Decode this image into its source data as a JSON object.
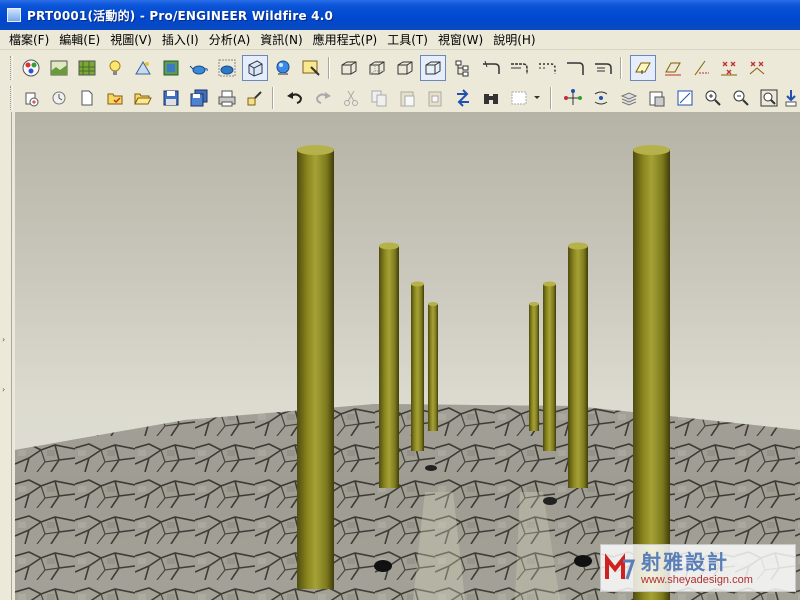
{
  "window": {
    "title": "PRT0001(活動的) - Pro/ENGINEER Wildfire 4.0"
  },
  "menu": {
    "items": [
      "檔案(F)",
      "編輯(E)",
      "視圖(V)",
      "插入(I)",
      "分析(A)",
      "資訊(N)",
      "應用程式(P)",
      "工具(T)",
      "視窗(W)",
      "說明(H)"
    ]
  },
  "toolbar": {
    "row1_icons": [
      "appearance-gallery-icon",
      "scene-icon",
      "texture-icon",
      "light-icon",
      "environment-icon",
      "room-icon",
      "render-teapot-icon",
      "render-region-teapot-icon",
      "render-window-icon",
      "render-preview-icon",
      "render-settings-icon",
      "wireframe-icon",
      "hidden-line-icon",
      "no-hidden-icon",
      "shaded-icon",
      "model-tree-display-icon",
      "saved-view-icon",
      "orient-icon",
      "repaint-icon",
      "spin-center-icon",
      "view-manager-icon",
      "datum-plane-display-icon",
      "datum-axis-display-icon",
      "datum-point-display-icon",
      "coordinate-system-display-icon"
    ],
    "row2_icons": [
      "new-icon",
      "open-icon",
      "save-icon",
      "print-icon",
      "email-icon",
      "undo-icon",
      "redo-icon",
      "cut-icon",
      "copy-icon",
      "paste-icon",
      "paste-special-icon",
      "regenerate-icon",
      "find-icon",
      "select-box-icon",
      "orient-mode-icon",
      "layers-icon",
      "zoom-in-icon",
      "zoom-out-icon",
      "refit-icon",
      "help-context-icon"
    ]
  },
  "viewport": {
    "scene_description": "3D rendered scene"
  },
  "watermark": {
    "chinese_text": "射雅設計",
    "url": "www.sheyadesign.com"
  },
  "colors": {
    "titlebar": "#0a54d6",
    "chrome": "#ece9d8",
    "pillar": "#7d7a1e",
    "pillar_highlight": "#a6a236",
    "pillar_shadow": "#4f4c10",
    "sky_top": "#b5b3a6",
    "sky_bottom": "#e3e2d9",
    "ground": "#8b8a82"
  }
}
